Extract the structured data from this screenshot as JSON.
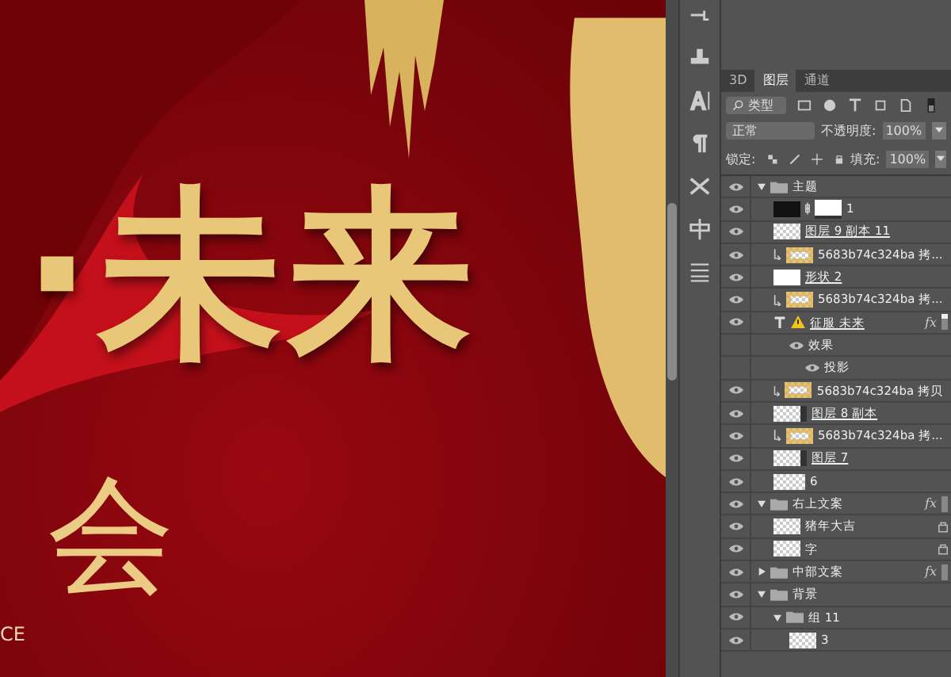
{
  "canvas": {
    "headline": "·未来",
    "subtitle": "会",
    "caption": "CE"
  },
  "layers_panel": {
    "tabs": [
      {
        "label": "3D",
        "selected": false
      },
      {
        "label": "图层",
        "selected": true
      },
      {
        "label": "通道",
        "selected": false
      }
    ],
    "filter": {
      "value": "类型"
    },
    "blend_mode": "正常",
    "opacity": {
      "label": "不透明度:",
      "value": "100%"
    },
    "lock": {
      "label": "锁定:"
    },
    "fill": {
      "label": "填充:",
      "value": "100%"
    },
    "layers": [
      {
        "name": "主题",
        "kind": "group",
        "visible": true,
        "expanded": true,
        "clipped": false,
        "underlined": false,
        "locked": false,
        "children": [
          {
            "name": "1",
            "kind": "masked",
            "visible": true,
            "clipped": false,
            "underlined": false,
            "locked": false
          },
          {
            "name": "图层 9 副本 11",
            "kind": "pixel",
            "visible": true,
            "clipped": false,
            "underlined": true,
            "locked": false
          },
          {
            "name": "5683b74c324ba 拷...",
            "kind": "gold",
            "visible": true,
            "clipped": true,
            "underlined": false,
            "locked": false
          },
          {
            "name": "形状 2",
            "kind": "shape",
            "visible": true,
            "clipped": false,
            "underlined": true,
            "locked": false
          },
          {
            "name": "5683b74c324ba 拷...",
            "kind": "gold",
            "visible": true,
            "clipped": true,
            "underlined": false,
            "locked": false
          },
          {
            "name": "征服 未来",
            "kind": "text",
            "visible": true,
            "clipped": false,
            "underlined": true,
            "locked": false,
            "warning": true,
            "badge": "fx",
            "expanded": true,
            "children": [
              {
                "name": "效果",
                "kind": "effects",
                "visible": true,
                "clipped": false,
                "underlined": false,
                "locked": false,
                "children": [
                  {
                    "name": "投影",
                    "kind": "effect",
                    "visible": true,
                    "clipped": false,
                    "underlined": false,
                    "locked": false
                  }
                ]
              }
            ]
          },
          {
            "name": "5683b74c324ba 拷贝",
            "kind": "gold",
            "visible": true,
            "clipped": true,
            "underlined": false,
            "locked": false
          },
          {
            "name": "图层 8 副本",
            "kind": "smart",
            "visible": true,
            "clipped": false,
            "underlined": true,
            "locked": false
          },
          {
            "name": "5683b74c324ba 拷...",
            "kind": "gold",
            "visible": true,
            "clipped": true,
            "underlined": false,
            "locked": false
          },
          {
            "name": "图层 7",
            "kind": "smart",
            "visible": true,
            "clipped": false,
            "underlined": true,
            "locked": false
          },
          {
            "name": "6",
            "kind": "wide",
            "visible": true,
            "clipped": false,
            "underlined": false,
            "locked": false
          }
        ]
      },
      {
        "name": "右上文案",
        "kind": "group",
        "visible": true,
        "expanded": true,
        "clipped": false,
        "underlined": false,
        "locked": false,
        "badge": "fx",
        "children": [
          {
            "name": "猪年大吉",
            "kind": "pixel",
            "visible": true,
            "clipped": false,
            "underlined": false,
            "locked": true
          },
          {
            "name": "字",
            "kind": "pixel",
            "visible": true,
            "clipped": false,
            "underlined": false,
            "locked": true
          }
        ]
      },
      {
        "name": "中部文案",
        "kind": "group",
        "visible": true,
        "expanded": false,
        "clipped": false,
        "underlined": false,
        "locked": false,
        "badge": "fx"
      },
      {
        "name": "背景",
        "kind": "group",
        "visible": true,
        "expanded": true,
        "clipped": false,
        "underlined": false,
        "locked": false,
        "children": [
          {
            "name": "组 11",
            "kind": "group",
            "visible": true,
            "expanded": true,
            "clipped": false,
            "underlined": false,
            "locked": false,
            "children": [
              {
                "name": "3",
                "kind": "pixel",
                "visible": true,
                "clipped": false,
                "underlined": false,
                "locked": false
              }
            ]
          }
        ]
      }
    ]
  }
}
